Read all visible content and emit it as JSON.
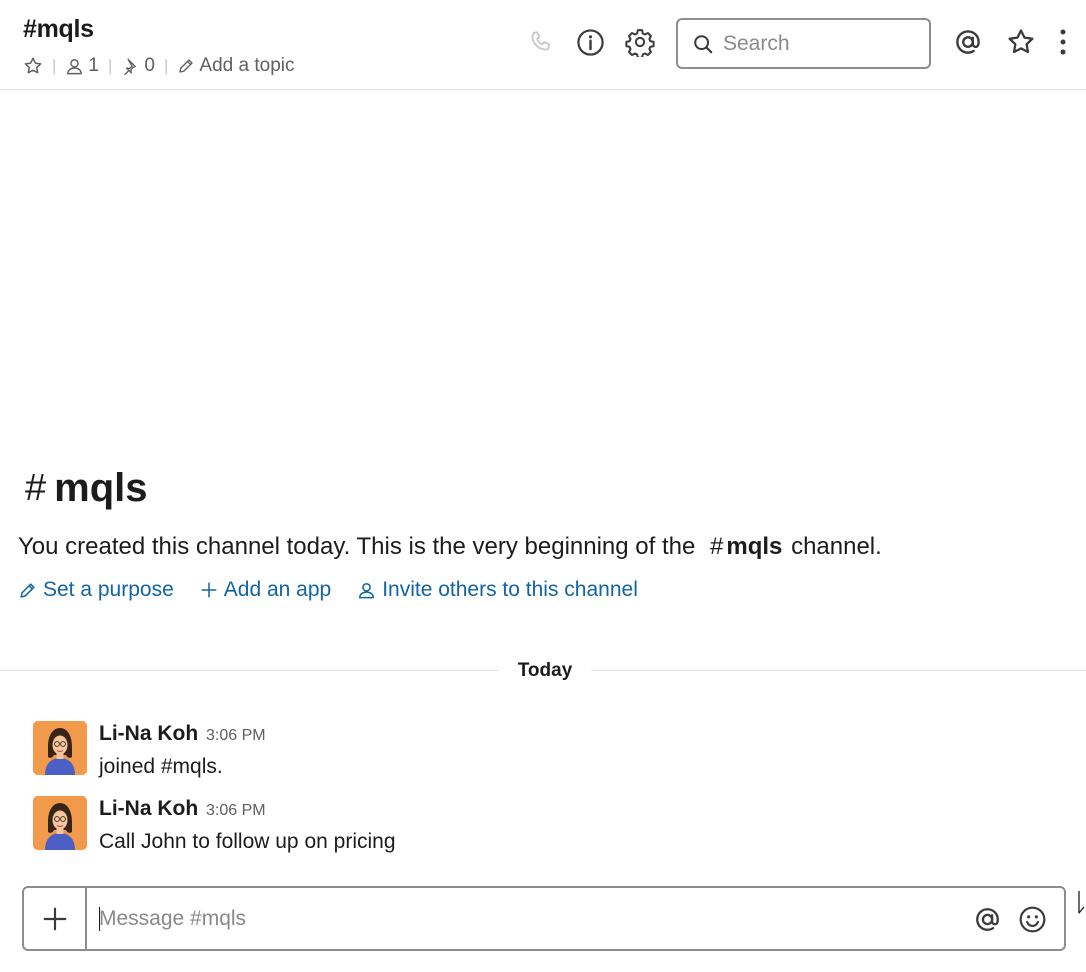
{
  "header": {
    "channel_name": "#mqls",
    "member_count": "1",
    "pinned_count": "0",
    "add_topic": "Add a topic",
    "search_placeholder": "Search"
  },
  "intro": {
    "hash": "#",
    "channel": "mqls",
    "text_before": "You created this channel today. This is the very beginning of the",
    "channel_hash": "#",
    "channel_ref": "mqls",
    "text_after": "channel.",
    "actions": {
      "set_purpose": "Set a purpose",
      "add_app": "Add an app",
      "invite": "Invite others to this channel"
    }
  },
  "divider": {
    "label": "Today"
  },
  "messages": [
    {
      "author": "Li-Na Koh",
      "time": "3:06 PM",
      "text": "joined #mqls."
    },
    {
      "author": "Li-Na Koh",
      "time": "3:06 PM",
      "text": "Call John to follow up on pricing"
    }
  ],
  "composer": {
    "placeholder": "Message #mqls"
  },
  "icons": {
    "star": "star-icon",
    "members": "person-icon",
    "pins": "pin-icon",
    "topic": "pencil-icon",
    "call": "phone-icon",
    "details": "info-icon",
    "settings": "gear-icon",
    "search": "search-icon",
    "mentions": "at-sign-icon",
    "starred": "star-icon",
    "more": "vertical-ellipsis-icon",
    "attach": "plus-icon",
    "emoji": "smiley-icon"
  },
  "colors": {
    "link": "#1264a3",
    "text": "#1d1c1d",
    "muted": "#616061",
    "border": "#8d8d8d",
    "avatar_bg": "#f29a4c"
  }
}
